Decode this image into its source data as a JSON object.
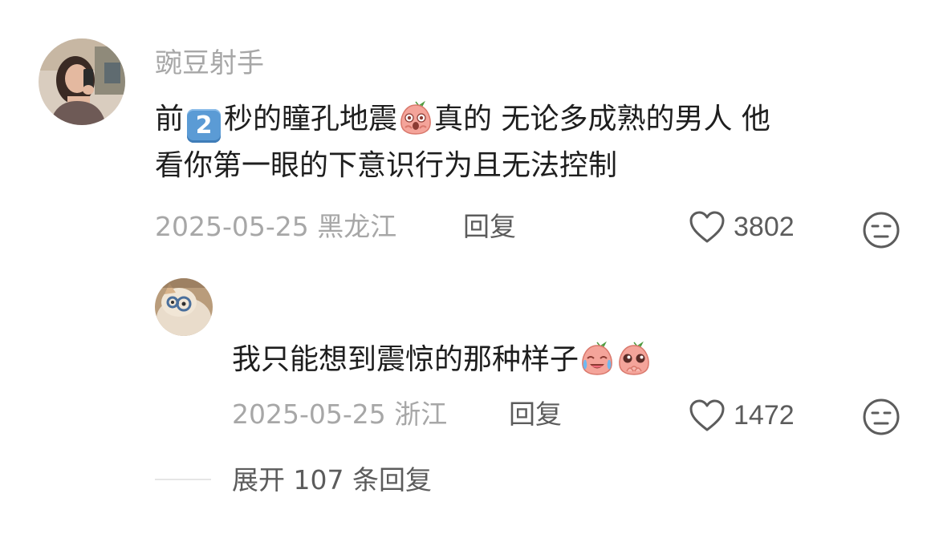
{
  "comment": {
    "username": "豌豆射手",
    "text_line1_a": "前",
    "keycap": "2",
    "text_line1_b": "秒的瞳孔地震",
    "text_line1_c": "真的 无论多成熟的男人 他",
    "text_line2": "看你第一眼的下意识行为且无法控制",
    "date_location": "2025-05-25 黑龙江",
    "reply_label": "回复",
    "like_count": "3802",
    "emoji": [
      "peach-shocked-emoji"
    ]
  },
  "reply": {
    "text": "我只能想到震惊的那种样子",
    "date_location": "2025-05-25 浙江",
    "reply_label": "回复",
    "like_count": "1472",
    "emoji": [
      "peach-crying-laugh-emoji",
      "peach-pleading-emoji"
    ]
  },
  "expand": {
    "label": "展开 107 条回复"
  },
  "icons": {
    "like": "heart-outline-icon",
    "dislike": "unamused-face-icon"
  },
  "colors": {
    "text_primary": "#1e1e1e",
    "text_secondary": "#a7a7a7",
    "text_action": "#5c5c5c",
    "keycap": "#5b9bd5",
    "peach": "#f4a49a"
  }
}
